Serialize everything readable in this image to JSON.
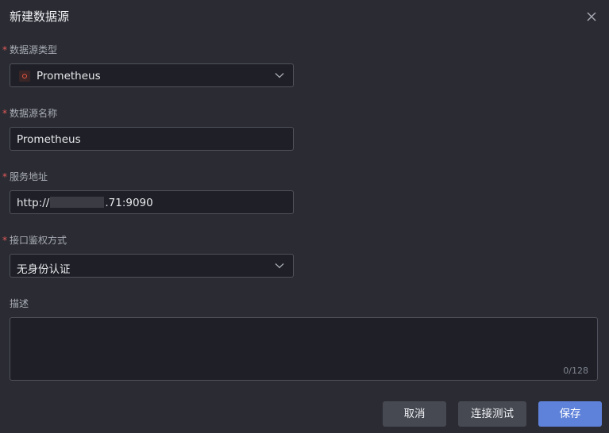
{
  "dialog": {
    "title": "新建数据源"
  },
  "form": {
    "type_label": "数据源类型",
    "type_value": "Prometheus",
    "name_label": "数据源名称",
    "name_value": "Prometheus",
    "url_label": "服务地址",
    "url_prefix": "http://",
    "url_suffix": ".71:9090",
    "auth_label": "接口鉴权方式",
    "auth_value": "无身份认证",
    "desc_label": "描述",
    "desc_counter": "0/128",
    "required_mark": "*"
  },
  "buttons": {
    "cancel": "取消",
    "test": "连接测试",
    "save": "保存"
  },
  "colors": {
    "accent": "#5e81d9",
    "required": "#e35b5b",
    "prometheus_brand": "#e6553f"
  },
  "icons": [
    "close-icon",
    "chevron-down-icon",
    "prometheus-icon"
  ]
}
